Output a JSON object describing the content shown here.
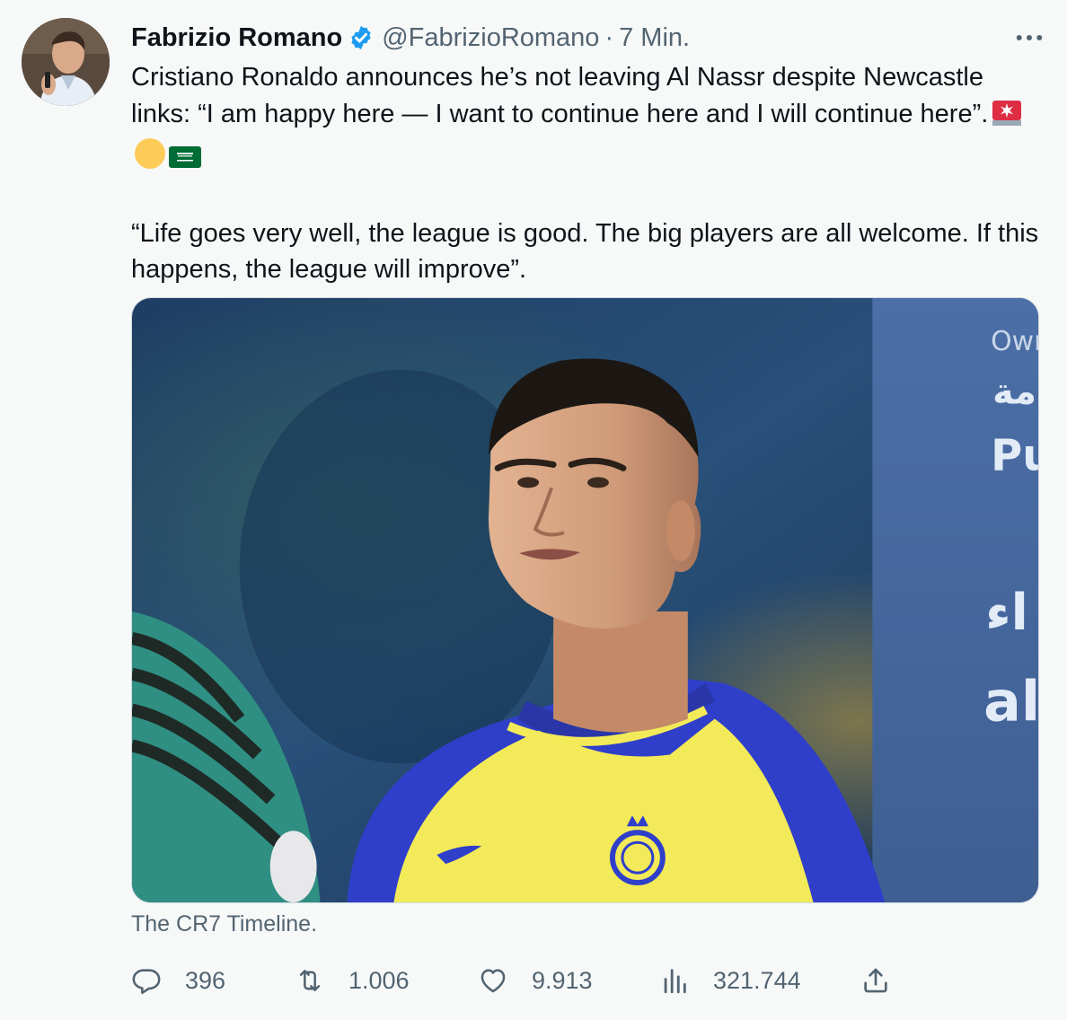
{
  "author": {
    "display_name": "Fabrizio Romano",
    "handle": "@FabrizioRomano",
    "separator": "·",
    "time": "7 Min.",
    "verified": true,
    "avatar_icon": "profile-photo"
  },
  "tweet": {
    "paragraph1": "Cristiano Ronaldo announces he’s not leaving Al Nassr despite Newcastle links: “I am happy here — I want to continue here and I will continue here”.",
    "paragraph1_emojis": [
      "police-light-emoji",
      "yellow-circle-emoji",
      "saudi-flag-emoji"
    ],
    "paragraph2": "“Life goes very well, the league is good. The big players are all welcome. If this happens, the league will improve”."
  },
  "media": {
    "image_icon": "cristiano-ronaldo-photo",
    "banner_text": [
      "Own",
      "مة",
      "Pu",
      "اء",
      "al"
    ]
  },
  "source_label": "The CR7 Timeline.",
  "actions": {
    "reply": {
      "icon": "reply-icon",
      "count": "396"
    },
    "retweet": {
      "icon": "retweet-icon",
      "count": "1.006"
    },
    "like": {
      "icon": "heart-icon",
      "count": "9.913"
    },
    "views": {
      "icon": "views-icon",
      "count": "321.744"
    },
    "share": {
      "icon": "share-icon"
    }
  },
  "colors": {
    "background": "#f7f9f9",
    "text": "#0f1419",
    "secondary_text": "#536471",
    "verified_blue": "#1d9bf0",
    "jersey_yellow": "#f2ea58",
    "jersey_blue": "#2f3fc9"
  }
}
